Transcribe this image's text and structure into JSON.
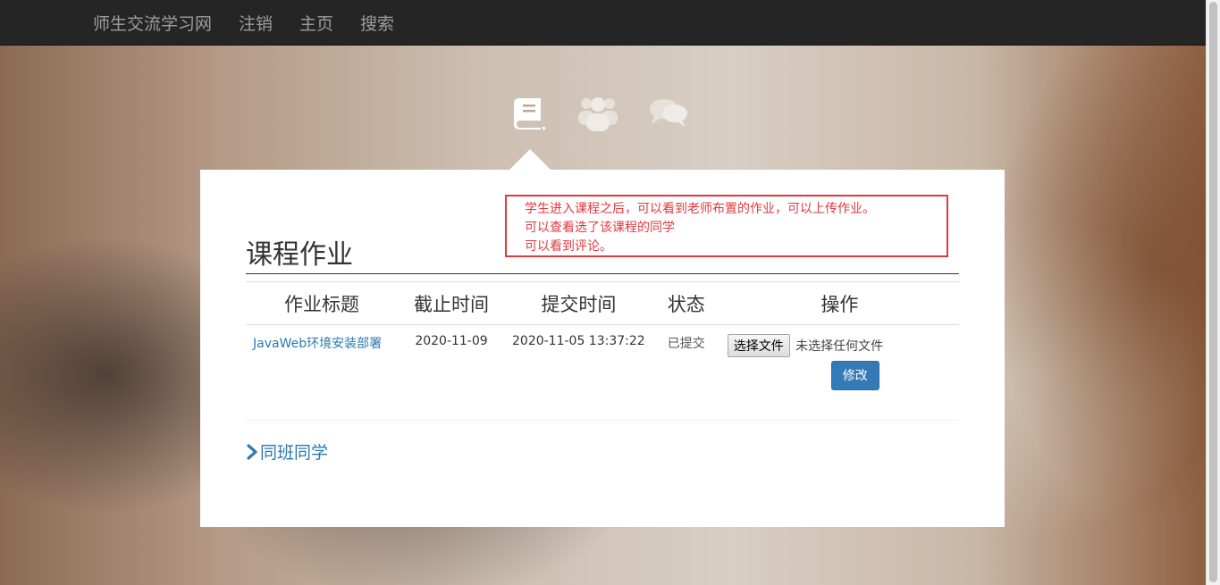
{
  "navbar": {
    "brand": "师生交流学习网",
    "items": [
      "注销",
      "主页",
      "搜索"
    ]
  },
  "icons": {
    "homework": "book-icon",
    "classmates": "users-icon",
    "comments": "comments-icon"
  },
  "note": {
    "lines": [
      "学生进入课程之后，可以看到老师布置的作业，可以上传作业。",
      "可以查看选了该课程的同学",
      "可以看到评论。"
    ],
    "color": "#e0393e"
  },
  "section": {
    "title": "课程作业"
  },
  "table": {
    "headers": [
      "作业标题",
      "截止时间",
      "提交时间",
      "状态",
      "操作"
    ],
    "rows": [
      {
        "title": "JavaWeb环境安装部署",
        "deadline": "2020-11-09",
        "submitted": "2020-11-05 13:37:22",
        "status": "已提交",
        "file_button": "选择文件",
        "file_status": "未选择任何文件",
        "modify_button": "修改"
      }
    ]
  },
  "classmates": {
    "label": "同班同学"
  },
  "colors": {
    "navbar_bg": "#252525",
    "link": "#2a7ab0",
    "primary_button": "#337ab7"
  }
}
